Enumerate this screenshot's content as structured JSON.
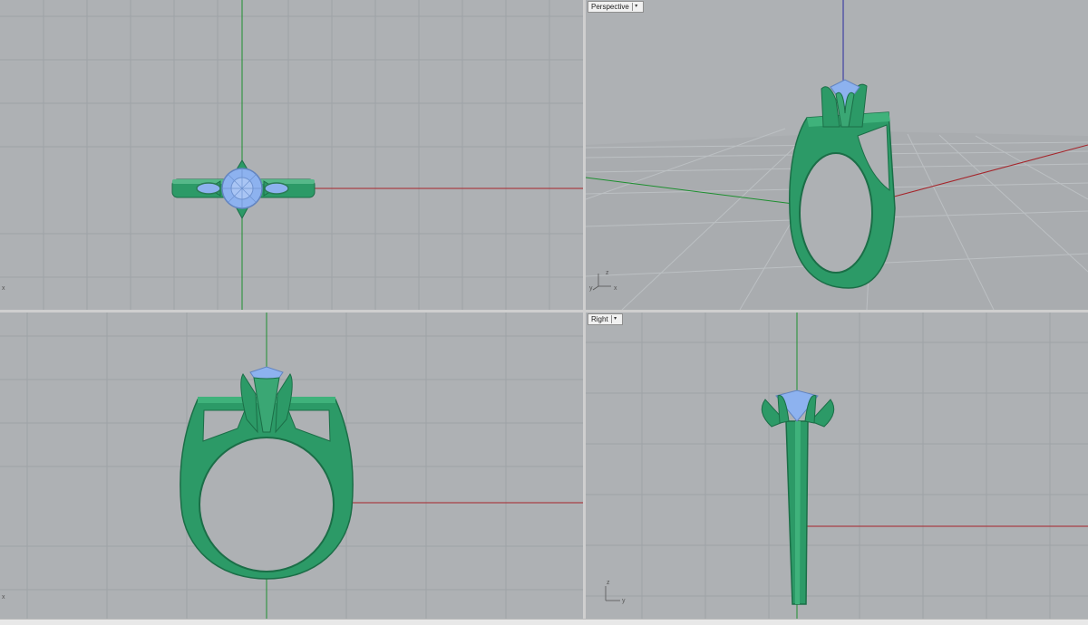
{
  "viewports": {
    "top": {
      "label": "",
      "axes": [
        "x"
      ]
    },
    "perspective": {
      "label": "Perspective",
      "axes": [
        "z",
        "y",
        "x"
      ]
    },
    "front": {
      "label": "",
      "axes": [
        "x"
      ]
    },
    "right": {
      "label": "Right",
      "axes": [
        "z",
        "y"
      ]
    }
  },
  "statusbar": {
    "text": ""
  },
  "colors": {
    "viewport_bg": "#aeb1b4",
    "grid": "#9ea2a6",
    "x_axis": "#a5242a",
    "y_axis": "#1d8f2f",
    "z_axis": "#2b2ba0",
    "ring_metal": "#2c9a67",
    "gem": "#8db2ef",
    "divider": "#e5e5e5"
  },
  "icons": [
    "dropdown-chevron-icon",
    "axis-gizmo-icon"
  ]
}
